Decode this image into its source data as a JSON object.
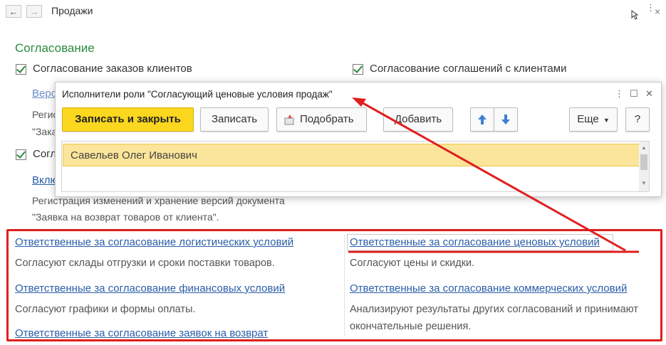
{
  "window": {
    "title": "Продажи",
    "back_icon": "←",
    "forward_icon": "→"
  },
  "section": {
    "title": "Согласование",
    "check_orders": "Согласование заказов клиентов",
    "check_agreements": "Согласование соглашений с клиентами",
    "link_versions_partial": "Верс",
    "reg_partial_1": "Регис",
    "reg_partial_2": "\"Зака",
    "check_partial": "Согл",
    "link_partial": "Вклю",
    "reg_text_1": "Регистрация изменений и хранение версий документа",
    "reg_text_2": "\"Заявка на возврат товаров от клиента\"."
  },
  "dialog": {
    "title": "Исполнители роли \"Согласующий ценовые условия продаж\"",
    "buttons": {
      "save_close": "Записать и закрыть",
      "save": "Записать",
      "pick": "Подобрать",
      "add": "Добавить",
      "more": "Еще",
      "help": "?"
    },
    "rows": [
      "Савельев Олег Иванович"
    ]
  },
  "responsibles": {
    "logistics_link": "Ответственные за согласование логистических условий",
    "logistics_desc": "Согласуют склады отгрузки и сроки поставки товаров.",
    "finance_link": "Ответственные за согласование финансовых условий",
    "finance_desc": "Согласуют графики и формы оплаты.",
    "returns_link": "Ответственные за согласование заявок на возврат",
    "price_link": "Ответственные за согласование ценовых условий",
    "price_desc": "Согласуют цены и скидки.",
    "commercial_link": "Ответственные за согласование коммерческих условий",
    "commercial_desc_1": "Анализируют результаты других согласований и принимают",
    "commercial_desc_2": "окончательные решения."
  },
  "colors": {
    "accent_green": "#2a8a3e",
    "link_blue": "#2a5ea8",
    "primary_yellow": "#fbd71f",
    "annotation_red": "#e01e1e"
  }
}
